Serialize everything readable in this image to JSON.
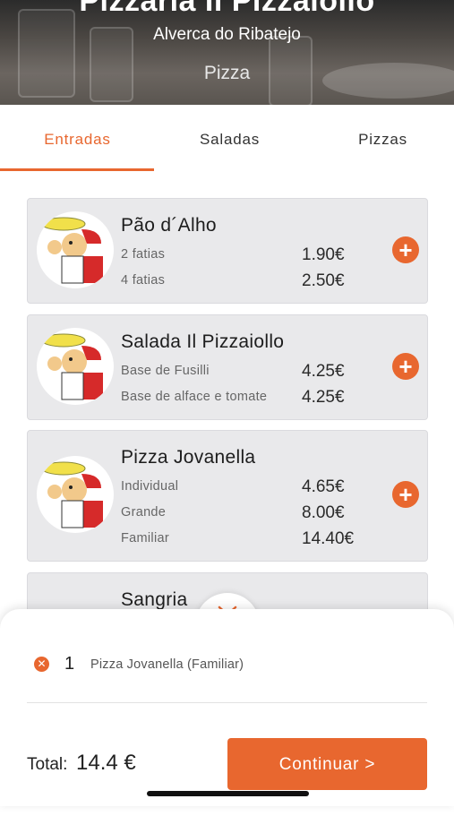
{
  "header": {
    "title": "Pizzaria Il Pizzaiollo",
    "location": "Alverca do Ribatejo",
    "category": "Pizza"
  },
  "tabs": [
    {
      "label": "Entradas",
      "active": true
    },
    {
      "label": "Saladas",
      "active": false
    },
    {
      "label": "Pizzas",
      "active": false
    }
  ],
  "menu_items": [
    {
      "name": "Pão d´Alho",
      "icon": "chef-mascot-logo",
      "options": [
        {
          "label": "2 fatias",
          "price": "1.90€"
        },
        {
          "label": "4 fatias",
          "price": "2.50€"
        }
      ]
    },
    {
      "name": "Salada Il Pizzaiollo",
      "icon": "chef-mascot-logo",
      "options": [
        {
          "label": "Base de Fusilli",
          "price": "4.25€"
        },
        {
          "label": "Base de alface e tomate",
          "price": "4.25€"
        }
      ]
    },
    {
      "name": "Pizza Jovanella",
      "icon": "chef-mascot-logo",
      "options": [
        {
          "label": "Individual",
          "price": "4.65€"
        },
        {
          "label": "Grande",
          "price": "8.00€"
        },
        {
          "label": "Familiar",
          "price": "14.40€"
        }
      ]
    },
    {
      "name": "Sangria",
      "icon": "chef-mascot-logo",
      "options": []
    }
  ],
  "cart": {
    "items": [
      {
        "qty": "1",
        "name": "Pizza Jovanella (Familiar)"
      }
    ],
    "total_label": "Total:",
    "total_value": "14.4 €",
    "continue_label": "Continuar >"
  },
  "colors": {
    "accent": "#e8672f",
    "card_bg": "#e9e9eb"
  }
}
